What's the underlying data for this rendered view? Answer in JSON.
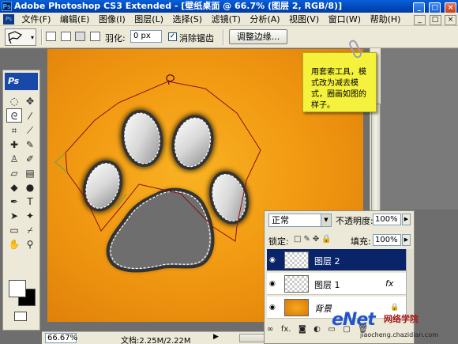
{
  "window": {
    "title": "Adobe Photoshop CS3 Extended - [壁纸桌面 @ 66.7% (图层 2, RGB/8)]",
    "app_icon": "Ps",
    "controls": [
      "_",
      "□",
      "×"
    ]
  },
  "menubar": {
    "items": [
      "文件(F)",
      "编辑(E)",
      "图像(I)",
      "图层(L)",
      "选择(S)",
      "滤镜(T)",
      "分析(A)",
      "视图(V)",
      "窗口(W)",
      "帮助(H)"
    ],
    "doc_controls": [
      "_",
      "□",
      "×"
    ]
  },
  "options": {
    "feather_label": "羽化:",
    "feather_value": "0 px",
    "antialias_label": "消除锯齿",
    "antialias_checked": true,
    "refine_edge_label": "调整边缘..."
  },
  "toolbox": {
    "logo": "Ps",
    "tools": [
      "marquee-icon",
      "move-icon",
      "lasso-icon",
      "magic-wand-icon",
      "crop-icon",
      "slice-icon",
      "healing-icon",
      "brush-icon",
      "stamp-icon",
      "history-brush-icon",
      "eraser-icon",
      "gradient-icon",
      "blur-icon",
      "dodge-icon",
      "pen-icon",
      "type-icon",
      "path-select-icon",
      "shape-icon",
      "notes-icon",
      "eyedropper-icon",
      "hand-icon",
      "zoom-icon"
    ],
    "foreground_color": "#ffffff",
    "background_color": "#000000"
  },
  "note": {
    "text": "用套索工具，模式改为减去模式，圈画如图的样子。"
  },
  "status": {
    "zoom": "66.67%",
    "doc_info": "文档:2.25M/2.22M"
  },
  "layers_panel": {
    "blend_mode": "正常",
    "opacity_label": "不透明度:",
    "opacity_value": "100%",
    "lock_label": "锁定:",
    "fill_label": "填充:",
    "fill_value": "100%",
    "layers": [
      {
        "name": "图层 2",
        "selected": true,
        "thumb": "transparent",
        "fx": "",
        "lock": ""
      },
      {
        "name": "图层 1",
        "selected": false,
        "thumb": "paw",
        "fx": "fx",
        "lock": ""
      },
      {
        "name": "背景",
        "selected": false,
        "thumb": "orange",
        "fx": "",
        "lock": "🔒"
      }
    ],
    "footer_icons": [
      "link-icon",
      "fx-icon",
      "mask-icon",
      "adjustment-icon",
      "group-icon",
      "new-layer-icon",
      "trash-icon"
    ]
  },
  "watermark": {
    "brand": "eNet",
    "tagline": "网络学院",
    "url": "jiaocheng.chazidian.com"
  },
  "colors": {
    "canvas_center": "#f8b222",
    "canvas_edge": "#dc7c08",
    "lasso_path": "#8b1010",
    "selection_row": "#0a246a"
  }
}
